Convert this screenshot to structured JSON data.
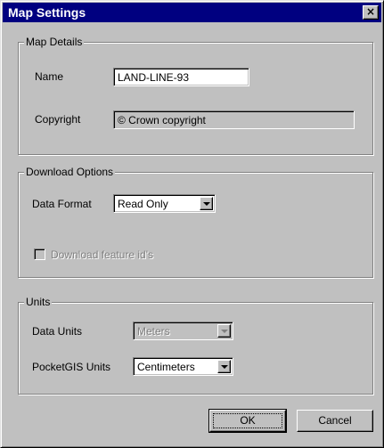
{
  "window": {
    "title": "Map Settings",
    "close_glyph": "×"
  },
  "map_details": {
    "legend": "Map Details",
    "name_label": "Name",
    "name_value": "LAND-LINE-93",
    "copyright_label": "Copyright",
    "copyright_value": "© Crown copyright"
  },
  "download_options": {
    "legend": "Download Options",
    "data_format_label": "Data Format",
    "data_format_value": "Read Only",
    "download_feature_ids_label": "Download feature id's",
    "download_feature_ids_checked": false
  },
  "units": {
    "legend": "Units",
    "data_units_label": "Data Units",
    "data_units_value": "Meters",
    "pocketgis_units_label": "PocketGIS Units",
    "pocketgis_units_value": "Centimeters"
  },
  "buttons": {
    "ok": "OK",
    "cancel": "Cancel"
  }
}
